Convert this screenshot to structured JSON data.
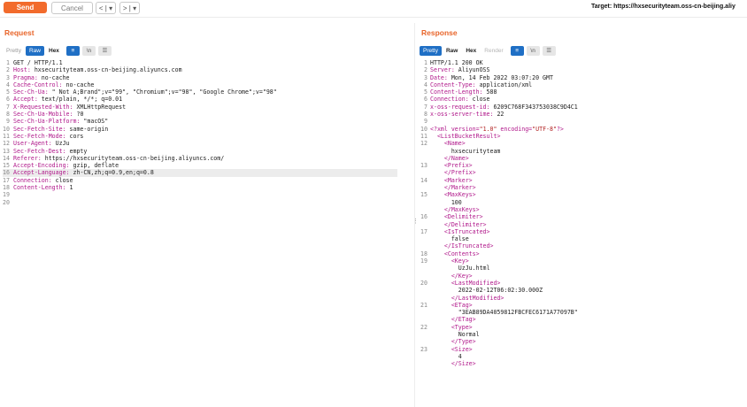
{
  "toolbar": {
    "send_label": "Send",
    "cancel_label": "Cancel",
    "back_label": "< | ▾",
    "forward_label": "> | ▾",
    "target_text": "Target: https://hxsecurityteam.oss-cn-beijing.aliy"
  },
  "request": {
    "title": "Request",
    "tabs": [
      "Pretty",
      "Raw",
      "Hex"
    ],
    "active_tab": "Raw",
    "icons": [
      "wrap-icon",
      "newline-icon",
      "menu-icon"
    ],
    "lines": [
      {
        "n": "1",
        "k": "",
        "v": "GET / HTTP/1.1"
      },
      {
        "n": "2",
        "k": "Host:",
        "v": " hxsecurityteam.oss-cn-beijing.aliyuncs.com"
      },
      {
        "n": "3",
        "k": "Pragma:",
        "v": " no-cache"
      },
      {
        "n": "4",
        "k": "Cache-Control:",
        "v": " no-cache"
      },
      {
        "n": "5",
        "k": "Sec-Ch-Ua:",
        "v": " \" Not A;Brand\";v=\"99\", \"Chromium\";v=\"98\", \"Google Chrome\";v=\"98\""
      },
      {
        "n": "6",
        "k": "Accept:",
        "v": " text/plain, */*; q=0.01"
      },
      {
        "n": "7",
        "k": "X-Requested-With:",
        "v": " XMLHttpRequest"
      },
      {
        "n": "8",
        "k": "Sec-Ch-Ua-Mobile:",
        "v": " ?0"
      },
      {
        "n": "9",
        "k": "Sec-Ch-Ua-Platform:",
        "v": " \"macOS\""
      },
      {
        "n": "10",
        "k": "Sec-Fetch-Site:",
        "v": " same-origin"
      },
      {
        "n": "11",
        "k": "Sec-Fetch-Mode:",
        "v": " cors"
      },
      {
        "n": "12",
        "k": "User-Agent:",
        "v": " UzJu"
      },
      {
        "n": "13",
        "k": "Sec-Fetch-Dest:",
        "v": " empty"
      },
      {
        "n": "14",
        "k": "Referer:",
        "v": " https://hxsecurityteam.oss-cn-beijing.aliyuncs.com/"
      },
      {
        "n": "15",
        "k": "Accept-Encoding:",
        "v": " gzip, deflate"
      },
      {
        "n": "16",
        "k": "Accept-Language:",
        "v": " zh-CN,zh;q=0.9,en;q=0.8",
        "highlight": true
      },
      {
        "n": "17",
        "k": "Connection:",
        "v": " close"
      },
      {
        "n": "18",
        "k": "Content-Length:",
        "v": " 1"
      },
      {
        "n": "19",
        "k": "",
        "v": ""
      },
      {
        "n": "20",
        "k": "",
        "v": ""
      }
    ]
  },
  "response": {
    "title": "Response",
    "tabs": [
      "Pretty",
      "Raw",
      "Hex",
      "Render"
    ],
    "active_tab": "Pretty",
    "icons": [
      "wrap-icon",
      "newline-icon",
      "menu-icon"
    ],
    "lines": [
      {
        "n": "1",
        "parts": [
          [
            "v",
            "HTTP/1.1 200 OK"
          ]
        ]
      },
      {
        "n": "2",
        "parts": [
          [
            "k",
            "Server:"
          ],
          [
            "v",
            " AliyunOSS"
          ]
        ]
      },
      {
        "n": "3",
        "parts": [
          [
            "k",
            "Date:"
          ],
          [
            "v",
            " Mon, 14 Feb 2022 03:07:20 GMT"
          ]
        ]
      },
      {
        "n": "4",
        "parts": [
          [
            "k",
            "Content-Type:"
          ],
          [
            "v",
            " application/xml"
          ]
        ]
      },
      {
        "n": "5",
        "parts": [
          [
            "k",
            "Content-Length:"
          ],
          [
            "v",
            " 588"
          ]
        ]
      },
      {
        "n": "6",
        "parts": [
          [
            "k",
            "Connection:"
          ],
          [
            "v",
            " close"
          ]
        ]
      },
      {
        "n": "7",
        "parts": [
          [
            "k",
            "x-oss-request-id:"
          ],
          [
            "v",
            " 6209C768F343753038C9D4C1"
          ]
        ]
      },
      {
        "n": "8",
        "parts": [
          [
            "k",
            "x-oss-server-time:"
          ],
          [
            "v",
            " 22"
          ]
        ]
      },
      {
        "n": "9",
        "parts": []
      },
      {
        "n": "10",
        "parts": [
          [
            "tag",
            "<?xml "
          ],
          [
            "attr",
            "version="
          ],
          [
            "str",
            "\"1.0\""
          ],
          [
            "attr",
            " encoding="
          ],
          [
            "str",
            "\"UTF-8\""
          ],
          [
            "tag",
            "?>"
          ]
        ]
      },
      {
        "n": "11",
        "parts": [
          [
            "txt",
            "  "
          ],
          [
            "tag",
            "<ListBucketResult>"
          ]
        ]
      },
      {
        "n": "12",
        "parts": [
          [
            "txt",
            "    "
          ],
          [
            "tag",
            "<Name>"
          ]
        ]
      },
      {
        "n": "",
        "parts": [
          [
            "txt",
            "      hxsecurityteam"
          ]
        ]
      },
      {
        "n": "",
        "parts": [
          [
            "txt",
            "    "
          ],
          [
            "tag",
            "</Name>"
          ]
        ]
      },
      {
        "n": "13",
        "parts": [
          [
            "txt",
            "    "
          ],
          [
            "tag",
            "<Prefix>"
          ]
        ]
      },
      {
        "n": "",
        "parts": [
          [
            "txt",
            "    "
          ],
          [
            "tag",
            "</Prefix>"
          ]
        ]
      },
      {
        "n": "14",
        "parts": [
          [
            "txt",
            "    "
          ],
          [
            "tag",
            "<Marker>"
          ]
        ]
      },
      {
        "n": "",
        "parts": [
          [
            "txt",
            "    "
          ],
          [
            "tag",
            "</Marker>"
          ]
        ]
      },
      {
        "n": "15",
        "parts": [
          [
            "txt",
            "    "
          ],
          [
            "tag",
            "<MaxKeys>"
          ]
        ]
      },
      {
        "n": "",
        "parts": [
          [
            "txt",
            "      100"
          ]
        ]
      },
      {
        "n": "",
        "parts": [
          [
            "txt",
            "    "
          ],
          [
            "tag",
            "</MaxKeys>"
          ]
        ]
      },
      {
        "n": "16",
        "parts": [
          [
            "txt",
            "    "
          ],
          [
            "tag",
            "<Delimiter>"
          ]
        ]
      },
      {
        "n": "",
        "parts": [
          [
            "txt",
            "    "
          ],
          [
            "tag",
            "</Delimiter>"
          ]
        ]
      },
      {
        "n": "17",
        "parts": [
          [
            "txt",
            "    "
          ],
          [
            "tag",
            "<IsTruncated>"
          ]
        ]
      },
      {
        "n": "",
        "parts": [
          [
            "txt",
            "      false"
          ]
        ]
      },
      {
        "n": "",
        "parts": [
          [
            "txt",
            "    "
          ],
          [
            "tag",
            "</IsTruncated>"
          ]
        ]
      },
      {
        "n": "18",
        "parts": [
          [
            "txt",
            "    "
          ],
          [
            "tag",
            "<Contents>"
          ]
        ]
      },
      {
        "n": "19",
        "parts": [
          [
            "txt",
            "      "
          ],
          [
            "tag",
            "<Key>"
          ]
        ]
      },
      {
        "n": "",
        "parts": [
          [
            "txt",
            "        UzJu.html"
          ]
        ]
      },
      {
        "n": "",
        "parts": [
          [
            "txt",
            "      "
          ],
          [
            "tag",
            "</Key>"
          ]
        ]
      },
      {
        "n": "20",
        "parts": [
          [
            "txt",
            "      "
          ],
          [
            "tag",
            "<LastModified>"
          ]
        ]
      },
      {
        "n": "",
        "parts": [
          [
            "txt",
            "        2022-02-12T06:02:30.000Z"
          ]
        ]
      },
      {
        "n": "",
        "parts": [
          [
            "txt",
            "      "
          ],
          [
            "tag",
            "</LastModified>"
          ]
        ]
      },
      {
        "n": "21",
        "parts": [
          [
            "txt",
            "      "
          ],
          [
            "tag",
            "<ETag>"
          ]
        ]
      },
      {
        "n": "",
        "parts": [
          [
            "txt",
            "        \"3EAB89DA4059812FBCFEC6171A77097B\""
          ]
        ]
      },
      {
        "n": "",
        "parts": [
          [
            "txt",
            "      "
          ],
          [
            "tag",
            "</ETag>"
          ]
        ]
      },
      {
        "n": "22",
        "parts": [
          [
            "txt",
            "      "
          ],
          [
            "tag",
            "<Type>"
          ]
        ]
      },
      {
        "n": "",
        "parts": [
          [
            "txt",
            "        Normal"
          ]
        ]
      },
      {
        "n": "",
        "parts": [
          [
            "txt",
            "      "
          ],
          [
            "tag",
            "</Type>"
          ]
        ]
      },
      {
        "n": "23",
        "parts": [
          [
            "txt",
            "      "
          ],
          [
            "tag",
            "<Size>"
          ]
        ]
      },
      {
        "n": "",
        "parts": [
          [
            "txt",
            "        4"
          ]
        ]
      },
      {
        "n": "",
        "parts": [
          [
            "txt",
            "      "
          ],
          [
            "tag",
            "</Size>"
          ]
        ]
      }
    ]
  },
  "colors": {
    "accent": "#f26b2c",
    "title": "#e8652a",
    "tab_active": "#1f6fc5",
    "syntax_key": "#b0178a",
    "syntax_string": "#b22222"
  }
}
